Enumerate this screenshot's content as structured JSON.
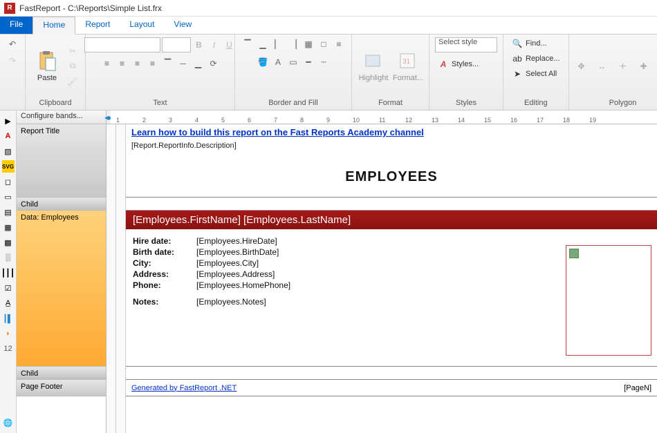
{
  "window": {
    "title": "FastReport - C:\\Reports\\Simple List.frx"
  },
  "menu": {
    "file": "File",
    "home": "Home",
    "report": "Report",
    "layout": "Layout",
    "view": "View"
  },
  "ribbon": {
    "clipboard": {
      "paste": "Paste",
      "label": "Clipboard"
    },
    "text": {
      "bold": "B",
      "italic": "I",
      "underline": "U",
      "label": "Text"
    },
    "borderfill": {
      "label": "Border and Fill"
    },
    "format": {
      "highlight": "Highlight",
      "formatbtn": "Format...",
      "label": "Format"
    },
    "styles": {
      "select": "Select style",
      "stylesbtn": "Styles...",
      "label": "Styles"
    },
    "editing": {
      "find": "Find...",
      "replace": "Replace...",
      "selectall": "Select All",
      "label": "Editing"
    },
    "polygon": {
      "label": "Polygon"
    }
  },
  "bands": {
    "configure": "Configure bands...",
    "reporttitle": "Report Title",
    "child1": "Child",
    "data": "Data: Employees",
    "child2": "Child",
    "pagefooter": "Page Footer"
  },
  "report": {
    "academy_link": "Learn how to build this report on the Fast Reports Academy channel",
    "description_expr": "[Report.ReportInfo.Description]",
    "title": "EMPLOYEES",
    "name_expr": "[Employees.FirstName] [Employees.LastName]",
    "fields": {
      "hiredate_label": "Hire date:",
      "hiredate_val": "[Employees.HireDate]",
      "birthdate_label": "Birth date:",
      "birthdate_val": "[Employees.BirthDate]",
      "city_label": "City:",
      "city_val": "[Employees.City]",
      "address_label": "Address:",
      "address_val": "[Employees.Address]",
      "phone_label": "Phone:",
      "phone_val": "[Employees.HomePhone]",
      "notes_label": "Notes:",
      "notes_val": "[Employees.Notes]"
    },
    "footer_generated": "Generated by FastReport .NET",
    "footer_pagen": "[PageN]"
  },
  "ruler": [
    "1",
    "2",
    "3",
    "4",
    "5",
    "6",
    "7",
    "8",
    "9",
    "10",
    "11",
    "12",
    "13",
    "14",
    "15",
    "16",
    "17",
    "18",
    "19"
  ]
}
